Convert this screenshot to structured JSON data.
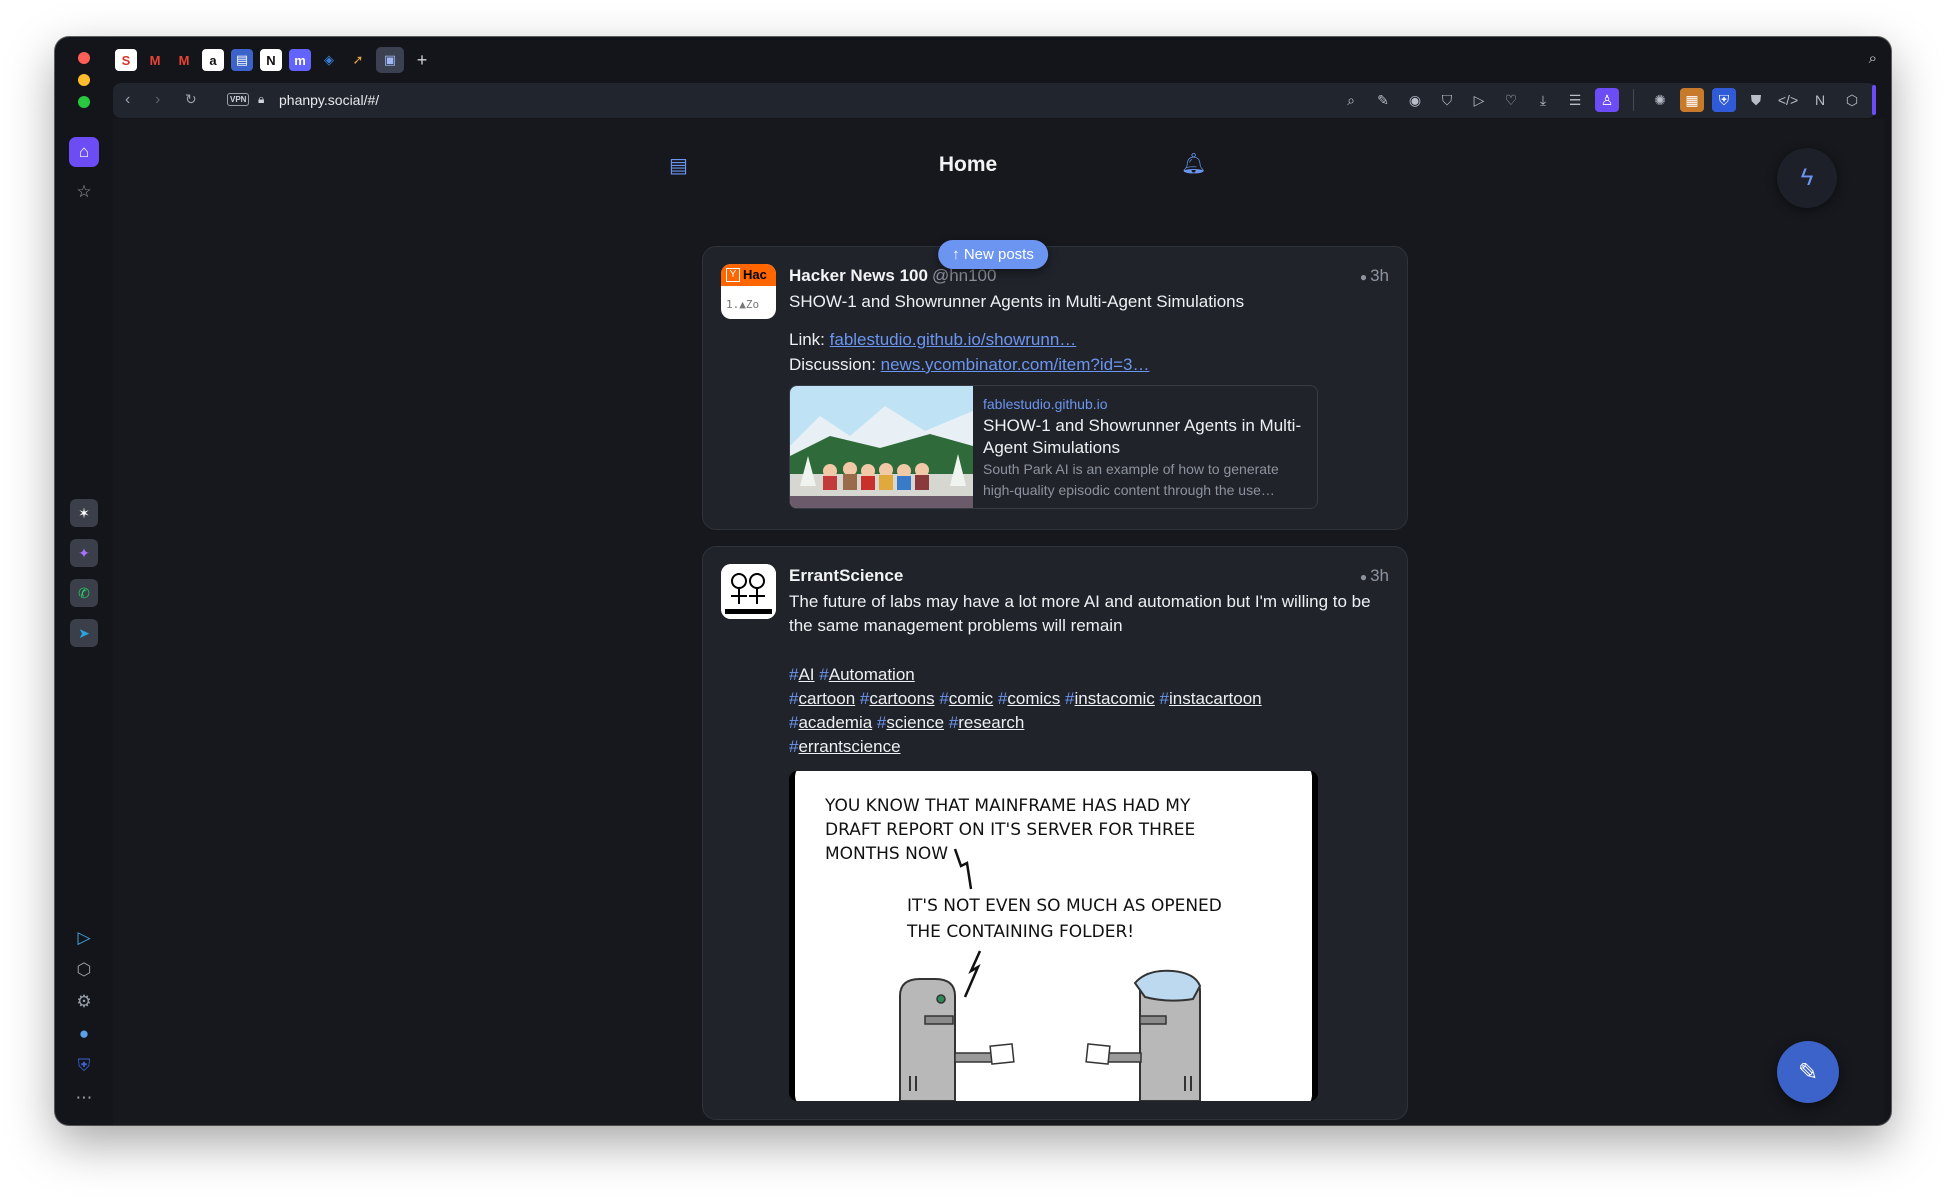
{
  "browser": {
    "url": "phanpy.social/#/",
    "vpn_label": "VPN",
    "tabs": [
      {
        "icon": "S",
        "color": "#d9342b"
      },
      {
        "icon": "M",
        "color": "#ea4335"
      },
      {
        "icon": "M",
        "color": "#ea4335"
      },
      {
        "icon": "a",
        "color": "#111111"
      },
      {
        "icon": "▤",
        "color": "#3b63c9"
      },
      {
        "icon": "N",
        "color": "#111111"
      },
      {
        "icon": "m",
        "color": "#6364ff"
      },
      {
        "icon": "◈",
        "color": "#3b7fd6"
      },
      {
        "icon": "➚",
        "color": "#e8a33b"
      },
      {
        "icon": "▣",
        "color": "#3b63c9"
      }
    ],
    "new_tab_icon": "+"
  },
  "app": {
    "header_title": "Home",
    "new_posts_label": "↑ New posts"
  },
  "posts": [
    {
      "display_name": "Hacker News 100",
      "handle": "@hn100",
      "time": "3h",
      "text": "SHOW-1 and Showrunner Agents in Multi-Agent Simulations",
      "link_label": "Link: ",
      "link_url": "fablestudio.github.io/showrunn…",
      "discussion_label": "Discussion: ",
      "discussion_url": "news.ycombinator.com/item?id=3…",
      "card": {
        "domain": "fablestudio.github.io",
        "title": "SHOW-1 and Showrunner Agents in Multi-Agent Simulations",
        "description": "South Park AI is an example of how to generate high-quality episodic content through the use…"
      },
      "avatar_text": "Hac"
    },
    {
      "display_name": "ErrantScience",
      "time": "3h",
      "text": "The future of labs may have a lot more AI and automation but I'm willing to be the same management problems will remain",
      "hashtag_lines": [
        [
          "AI",
          "Automation"
        ],
        [
          "cartoon",
          "cartoons",
          "comic",
          "comics",
          "instacomic",
          "instacartoon"
        ],
        [
          "academia",
          "science",
          "research"
        ],
        [
          "errantscience"
        ]
      ],
      "comic": {
        "caption1_line1": "YOU KNOW THAT MAINFRAME HAS HAD MY",
        "caption1_line2": "DRAFT REPORT ON IT'S SERVER FOR THREE",
        "caption1_line3": "MONTHS NOW",
        "caption2_line1": "IT'S NOT EVEN SO MUCH AS OPENED",
        "caption2_line2": "THE CONTAINING FOLDER!"
      }
    }
  ]
}
